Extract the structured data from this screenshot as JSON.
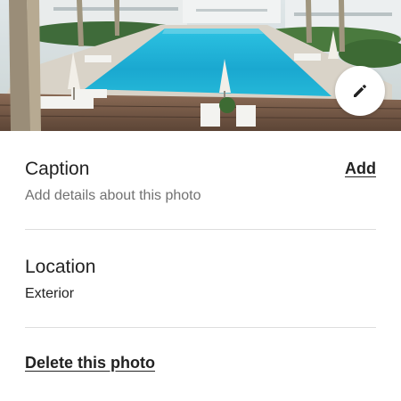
{
  "photo": {
    "edit_icon": "pencil-icon"
  },
  "caption": {
    "title": "Caption",
    "add_label": "Add",
    "placeholder": "Add details about this photo"
  },
  "location": {
    "title": "Location",
    "value": "Exterior"
  },
  "actions": {
    "delete_label": "Delete this photo"
  },
  "colors": {
    "text_primary": "#222222",
    "text_secondary": "#717171",
    "divider": "#dddddd",
    "pool_water": "#1fb3d6"
  }
}
